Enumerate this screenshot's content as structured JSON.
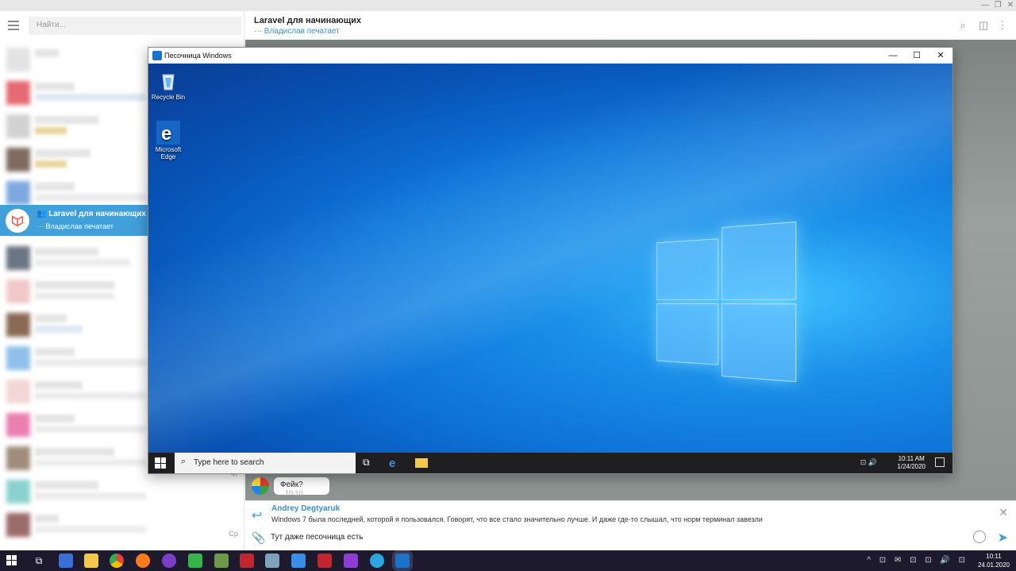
{
  "sidebar": {
    "search_placeholder": "Найти...",
    "active_chat": {
      "title": "Laravel для начинающих",
      "status": "··· Владислав печатает"
    },
    "row_dates": [
      "Чт",
      "Ср"
    ]
  },
  "chat": {
    "title": "Laravel для начинающих",
    "status": "··· Владислав печатает",
    "message": {
      "text": "Фейк?",
      "time": "10:10"
    },
    "reply": {
      "author": "Andrey Degtyaruk",
      "text": "Windows 7 была последней, которой я пользовался. Говорят, что все стало значительно лучше. И даже где-то слышал, что  норм терминал завезли"
    },
    "input_text": "Тут даже песочница есть"
  },
  "sandbox": {
    "title": "Песочница Windows",
    "desktop_icons": [
      {
        "label": "Recycle Bin",
        "icon": "recycle-bin-icon"
      },
      {
        "label": "Microsoft Edge",
        "icon": "edge-icon"
      }
    ],
    "taskbar": {
      "search_placeholder": "Type here to search",
      "time": "10:11 AM",
      "date": "1/24/2020"
    }
  },
  "host_taskbar": {
    "time": "10:11",
    "date": "24.01.2020"
  },
  "colors": {
    "accent": "#419fd9",
    "windows_blue": "#0f74d8",
    "taskbar": "#1c1a2c"
  }
}
